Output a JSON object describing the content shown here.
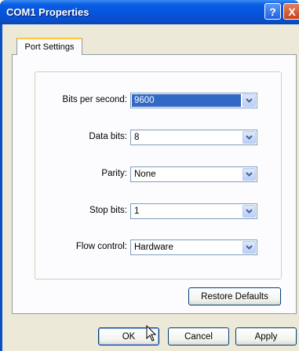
{
  "window": {
    "title": "COM1 Properties"
  },
  "title_buttons": {
    "help": "?",
    "close": "X"
  },
  "tabs": [
    {
      "label": "Port Settings",
      "active": true
    }
  ],
  "fields": [
    {
      "label": "Bits per second:",
      "value": "9600",
      "selected": true
    },
    {
      "label": "Data bits:",
      "value": "8"
    },
    {
      "label": "Parity:",
      "value": "None"
    },
    {
      "label": "Stop bits:",
      "value": "1"
    },
    {
      "label": "Flow control:",
      "value": "Hardware"
    }
  ],
  "buttons": {
    "restore": "Restore Defaults",
    "ok": "OK",
    "cancel": "Cancel",
    "apply": "Apply"
  },
  "colors": {
    "titlebar": "#0553dc",
    "selection": "#316ac5",
    "tab_highlight": "#ffc83c"
  }
}
